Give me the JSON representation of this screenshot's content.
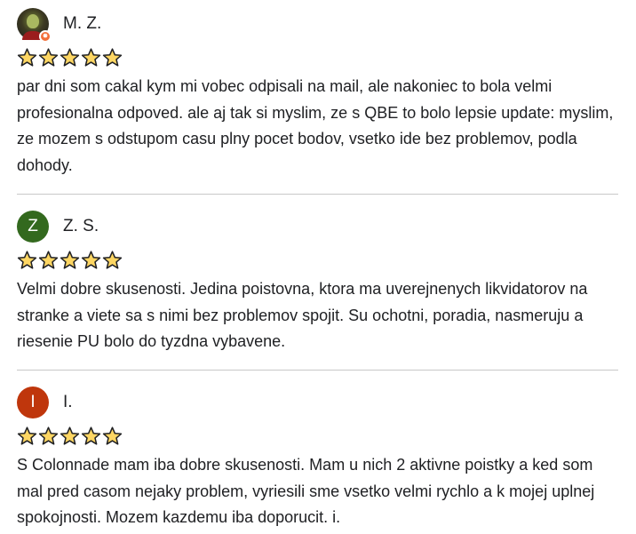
{
  "colors": {
    "star_fill": "#fdd663",
    "star_stroke": "#202124",
    "avatar_zs": "#33691e",
    "avatar_i": "#bf360c",
    "badge": "#f36f38"
  },
  "reviews": [
    {
      "name": "M. Z.",
      "avatar": {
        "type": "photo",
        "badge_icon": "local-guide-badge-icon"
      },
      "rating": 5,
      "text": "par dni som cakal kym mi vobec odpisali na mail, ale nakoniec to bola velmi profesionalna odpoved. ale aj tak si myslim, ze s QBE to bolo lepsie update: myslim, ze mozem s odstupom casu plny pocet bodov, vsetko ide bez problemov, podla dohody."
    },
    {
      "name": "Z. S.",
      "avatar": {
        "type": "letter",
        "letter": "Z"
      },
      "rating": 5,
      "text": "Velmi dobre skusenosti. Jedina poistovna, ktora ma uverejnenych likvidatorov na stranke a viete sa s nimi bez problemov spojit. Su ochotni, poradia, nasmeruju a riesenie PU bolo do tyzdna vybavene."
    },
    {
      "name": "I.",
      "avatar": {
        "type": "letter",
        "letter": "I"
      },
      "rating": 5,
      "text": "S Colonnade mam iba dobre skusenosti. Mam u nich 2 aktivne poistky a ked som mal pred casom nejaky problem, vyriesili sme vsetko velmi rychlo a k mojej uplnej spokojnosti. Mozem kazdemu iba doporucit. i."
    }
  ]
}
